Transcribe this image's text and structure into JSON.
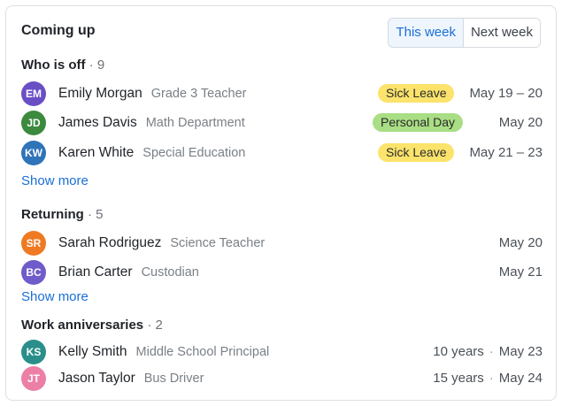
{
  "card": {
    "title": "Coming up",
    "toggle": {
      "this_week": "This week",
      "next_week": "Next week"
    }
  },
  "who_is_off": {
    "title": "Who is off",
    "count": "· 9",
    "show_more": "Show more",
    "people": [
      {
        "initials": "EM",
        "name": "Emily Morgan",
        "role": "Grade 3 Teacher",
        "badge": "Sick Leave",
        "dates": "May 19 – 20",
        "avatar_color": "#6a4fc4"
      },
      {
        "initials": "JD",
        "name": "James Davis",
        "role": "Math Department",
        "badge": "Personal Day",
        "dates": "May 20",
        "avatar_color": "#3b8a3e"
      },
      {
        "initials": "KW",
        "name": "Karen White",
        "role": "Special Education",
        "badge": "Sick Leave",
        "dates": "May 21 – 23",
        "avatar_color": "#2f73b8"
      }
    ]
  },
  "returning": {
    "title": "Returning",
    "count": "· 5",
    "show_more": "Show more",
    "people": [
      {
        "initials": "SR",
        "name": "Sarah Rodriguez",
        "role": "Science Teacher",
        "dates": "May 20",
        "avatar_color": "#f07a22"
      },
      {
        "initials": "BC",
        "name": "Brian Carter",
        "role": "Custodian",
        "dates": "May 21",
        "avatar_color": "#6f5bc9"
      }
    ]
  },
  "anniversaries": {
    "title": "Work anniversaries",
    "count": "· 2",
    "people": [
      {
        "initials": "KS",
        "name": "Kelly Smith",
        "role": "Middle School Principal",
        "years": "10 years",
        "date": "May 23",
        "avatar_color": "#2a8f8a"
      },
      {
        "initials": "JT",
        "name": "Jason Taylor",
        "role": "Bus Driver",
        "years": "15 years",
        "date": "May 24",
        "avatar_color": "#ec7fa6"
      }
    ]
  },
  "separator": "·"
}
